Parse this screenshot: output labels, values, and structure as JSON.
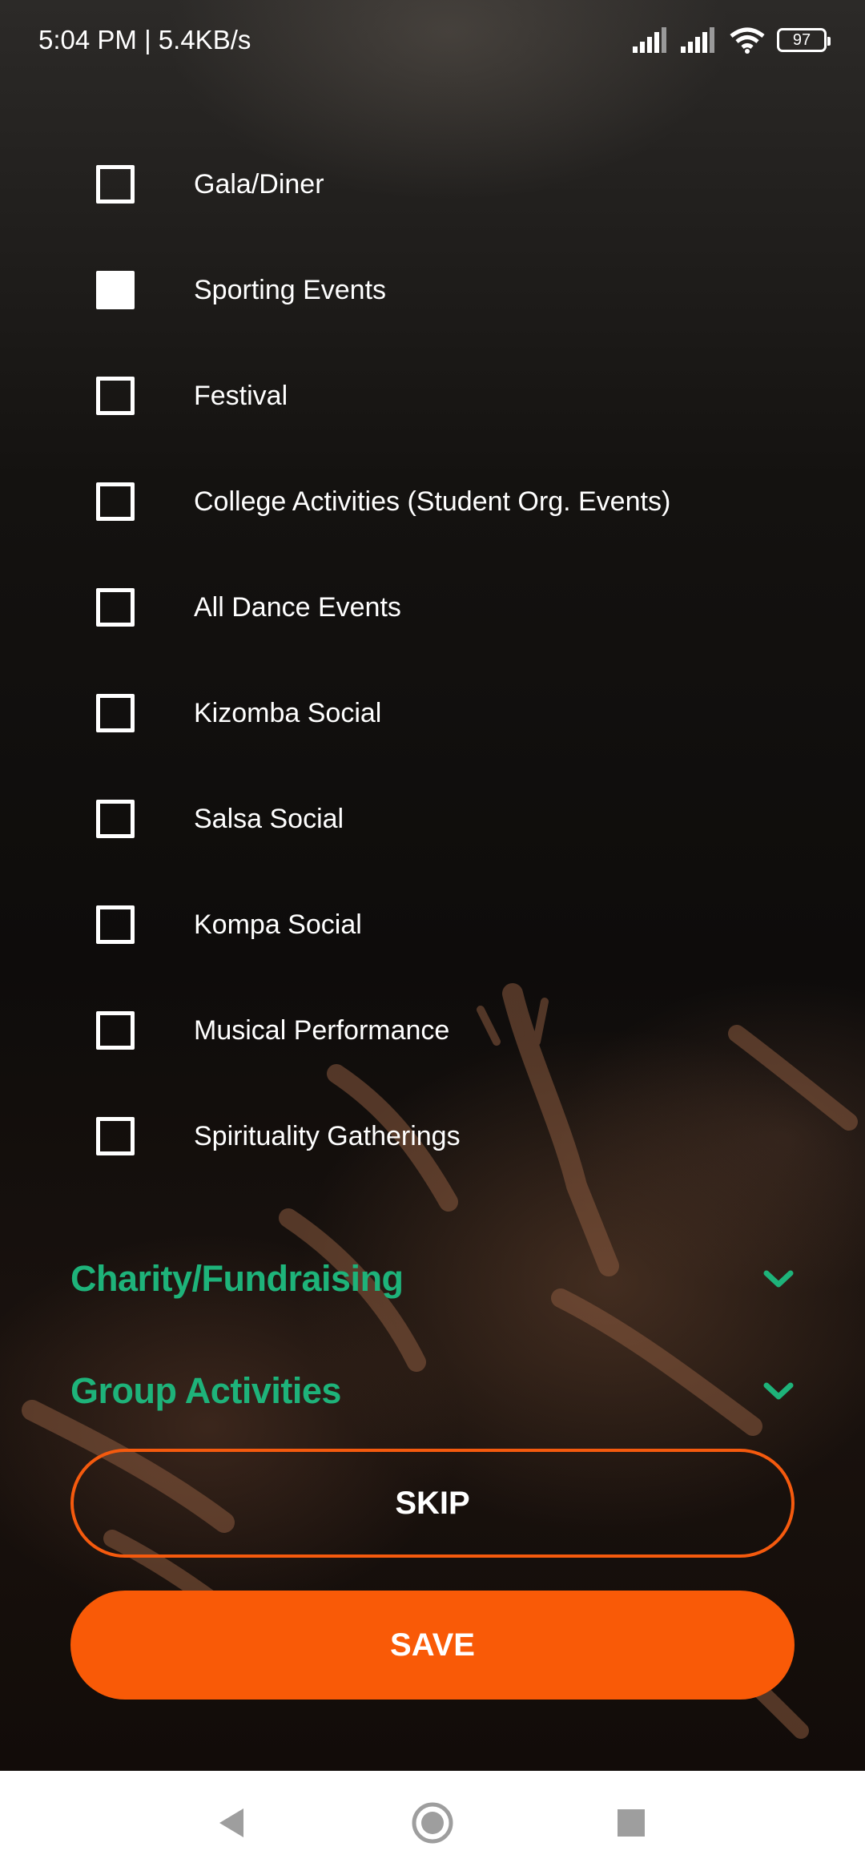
{
  "status_bar": {
    "time_speed": "5:04 PM | 5.4KB/s",
    "battery": "97",
    "icons": [
      "signal-icon",
      "signal-icon",
      "wifi-icon",
      "battery-icon"
    ]
  },
  "options": [
    {
      "label": "Gala/Diner",
      "checked": false
    },
    {
      "label": "Sporting Events",
      "checked": true
    },
    {
      "label": "Festival",
      "checked": false
    },
    {
      "label": "College Activities (Student Org. Events)",
      "checked": false
    },
    {
      "label": "All Dance Events",
      "checked": false
    },
    {
      "label": "Kizomba Social",
      "checked": false
    },
    {
      "label": "Salsa Social",
      "checked": false
    },
    {
      "label": "Kompa Social",
      "checked": false
    },
    {
      "label": "Musical Performance",
      "checked": false
    },
    {
      "label": "Spirituality Gatherings",
      "checked": false
    }
  ],
  "sections": [
    {
      "title": "Charity/Fundraising",
      "icon": "chevron-down-icon"
    },
    {
      "title": "Group Activities",
      "icon": "chevron-down-icon"
    }
  ],
  "buttons": {
    "skip": "SKIP",
    "save": "SAVE"
  },
  "colors": {
    "accent_green": "#1eb37a",
    "accent_orange": "#f95a07"
  },
  "nav_bar": {
    "icons": [
      "back-icon",
      "home-icon",
      "recents-icon"
    ]
  }
}
